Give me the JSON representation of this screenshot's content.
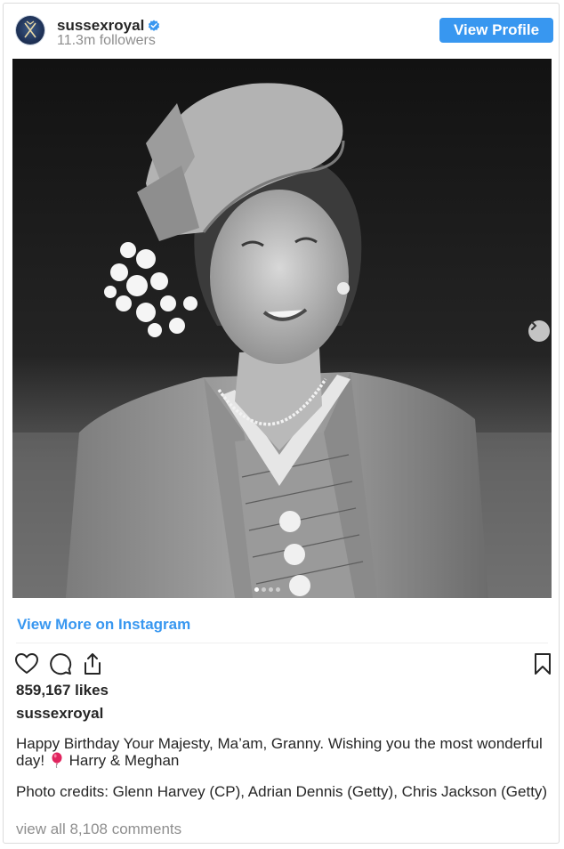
{
  "profile": {
    "username": "sussexroyal",
    "followers": "11.3m followers",
    "view_profile_label": "View Profile",
    "avatar_icon": "royal-cypher-icon",
    "verified_icon": "verified-badge-icon"
  },
  "post": {
    "image_alt": "Black and white portrait of a young woman in a hat with flowers and pearl necklace",
    "carousel": {
      "total": 4,
      "active_index": 0
    },
    "next_icon": "chevron-right-icon"
  },
  "view_more_label": "View More on Instagram",
  "actions": {
    "like_icon": "heart-icon",
    "comment_icon": "comment-icon",
    "share_icon": "share-icon",
    "save_icon": "bookmark-icon"
  },
  "likes": "859,167 likes",
  "caption": {
    "username": "sussexroyal",
    "text_part1": "Happy Birthday Your Majesty, Ma’am, Granny. Wishing you the most wonderful day! ",
    "emoji": "balloon-icon",
    "text_part2": " Harry & Meghan",
    "credits": "Photo credits: Glenn Harvey (CP), Adrian Dennis (Getty), Chris Jackson (Getty)"
  },
  "comments_label": "view all 8,108 comments",
  "colors": {
    "accent": "#3897f0",
    "text": "#262626",
    "muted": "#8e8e8e",
    "border": "#dbdbdb"
  }
}
